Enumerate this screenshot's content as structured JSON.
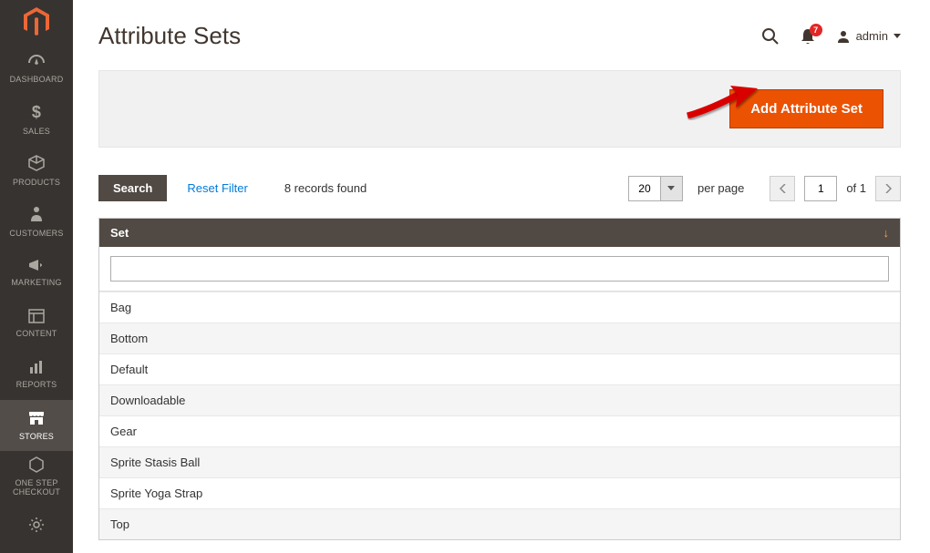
{
  "sidebar": {
    "items": [
      {
        "label": "DASHBOARD"
      },
      {
        "label": "SALES"
      },
      {
        "label": "PRODUCTS"
      },
      {
        "label": "CUSTOMERS"
      },
      {
        "label": "MARKETING"
      },
      {
        "label": "CONTENT"
      },
      {
        "label": "REPORTS"
      },
      {
        "label": "STORES"
      },
      {
        "label": "ONE STEP CHECKOUT"
      },
      {
        "label": ""
      }
    ],
    "active_index": 7
  },
  "header": {
    "title": "Attribute Sets",
    "notif_count": "7",
    "user_label": "admin"
  },
  "actions": {
    "add_label": "Add Attribute Set"
  },
  "toolbar": {
    "search_label": "Search",
    "reset_label": "Reset Filter",
    "records_text": "8 records found",
    "per_page_value": "20",
    "per_page_label": "per page",
    "page_value": "1",
    "of_label": "of 1"
  },
  "grid": {
    "column_label": "Set",
    "filter_value": "",
    "rows": [
      "Bag",
      "Bottom",
      "Default",
      "Downloadable",
      "Gear",
      "Sprite Stasis Ball",
      "Sprite Yoga Strap",
      "Top"
    ]
  }
}
